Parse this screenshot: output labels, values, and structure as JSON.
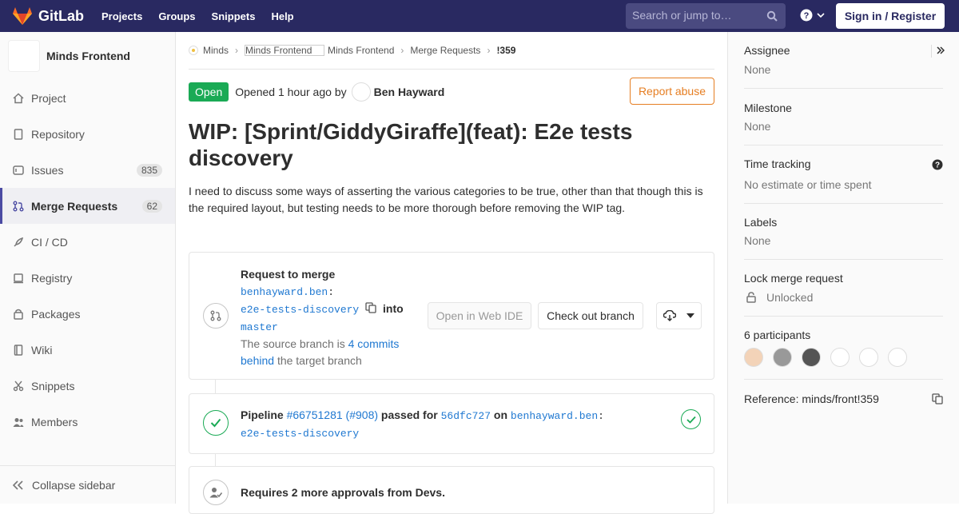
{
  "topbar": {
    "brand": "GitLab",
    "nav": [
      "Projects",
      "Groups",
      "Snippets",
      "Help"
    ],
    "search_placeholder": "Search or jump to…",
    "signin_label": "Sign in / Register"
  },
  "sidebar": {
    "project_name": "Minds Frontend",
    "items": [
      {
        "label": "Project",
        "icon": "home-icon"
      },
      {
        "label": "Repository",
        "icon": "doc-icon"
      },
      {
        "label": "Issues",
        "icon": "issues-icon",
        "count": "835"
      },
      {
        "label": "Merge Requests",
        "icon": "merge-request-icon",
        "count": "62",
        "active": true
      },
      {
        "label": "CI / CD",
        "icon": "rocket-icon"
      },
      {
        "label": "Registry",
        "icon": "container-icon"
      },
      {
        "label": "Packages",
        "icon": "package-icon"
      },
      {
        "label": "Wiki",
        "icon": "book-icon"
      },
      {
        "label": "Snippets",
        "icon": "scissors-icon"
      },
      {
        "label": "Members",
        "icon": "users-icon"
      }
    ],
    "collapse_label": "Collapse sidebar"
  },
  "breadcrumb": {
    "group": "Minds",
    "project_img_alt": "Minds Frontend",
    "project": "Minds Frontend",
    "section": "Merge Requests",
    "current": "!359"
  },
  "mr": {
    "status": "Open",
    "opened_text": "Opened",
    "time_ago": "1 hour ago",
    "by": "by",
    "author": "Ben Hayward",
    "report_label": "Report abuse",
    "title": "WIP: [Sprint/GiddyGiraffe](feat): E2e tests discovery",
    "description": "I need to discuss some ways of asserting the various categories to be true, other than that though this is the required layout, but testing needs to be more thorough before removing the WIP tag."
  },
  "merge_widget": {
    "heading": "Request to merge",
    "source_ns": "benhayward.ben",
    "colon": ":",
    "source_branch": "e2e-tests-discovery",
    "into": "into",
    "target_branch": "master",
    "behind_prefix": "The source branch is",
    "behind_link_1": "4 commits",
    "behind_link_2": "behind",
    "behind_suffix": "the target branch",
    "web_ide_label": "Open in Web IDE",
    "checkout_label": "Check out branch"
  },
  "pipeline": {
    "label": "Pipeline",
    "id": "#66751281",
    "iid": "(#908)",
    "passed_for": "passed for",
    "commit": "56dfc727",
    "on": "on",
    "ns": "benhayward.ben",
    "colon": ":",
    "branch": "e2e-tests-discovery"
  },
  "approvals": {
    "text": "Requires 2 more approvals from Devs."
  },
  "right_sidebar": {
    "assignee_title": "Assignee",
    "assignee_value": "None",
    "milestone_title": "Milestone",
    "milestone_value": "None",
    "time_title": "Time tracking",
    "time_value": "No estimate or time spent",
    "labels_title": "Labels",
    "labels_value": "None",
    "lock_title": "Lock merge request",
    "lock_value": "Unlocked",
    "participants_title": "6 participants",
    "reference": "Reference: minds/front!359"
  },
  "colors": {
    "topbar": "#292961",
    "open_green": "#1aaa55",
    "link_blue": "#1f78d1",
    "report_orange": "#e67e22"
  }
}
